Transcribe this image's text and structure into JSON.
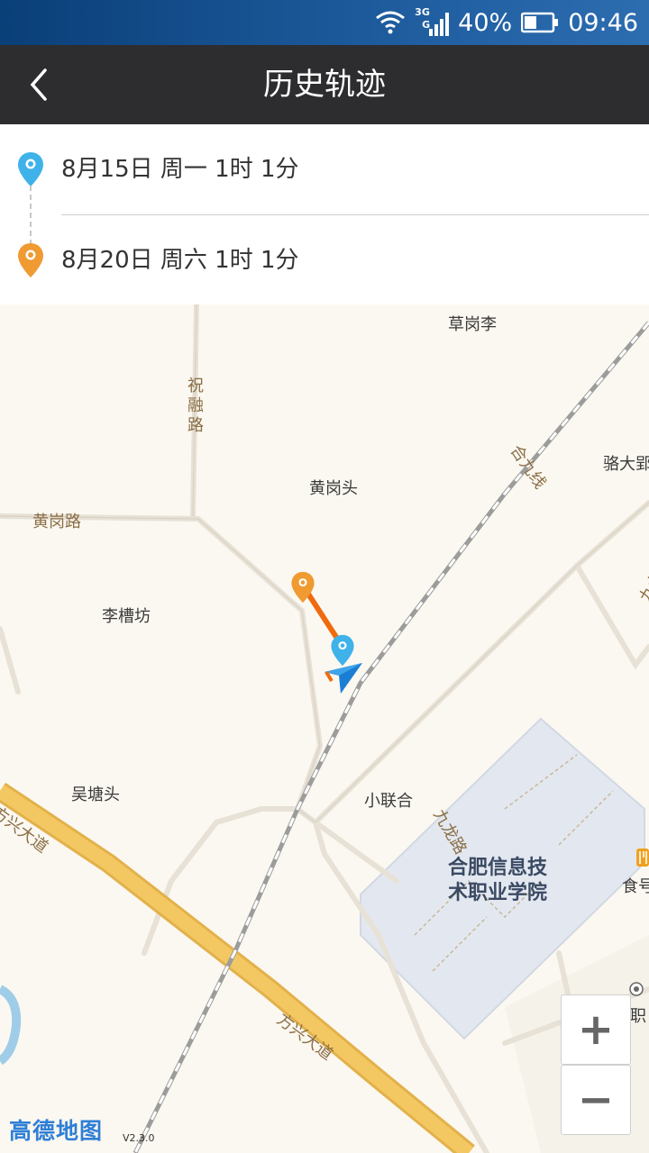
{
  "status_bar": {
    "network": "3G",
    "signal_sub": "G",
    "battery": "40%",
    "time": "09:46"
  },
  "header": {
    "title": "历史轨迹"
  },
  "trips": [
    {
      "label": "8月15日 周一 1时 1分",
      "pin_color": "#3fb2ea"
    },
    {
      "label": "8月20日 周六 1时 1分",
      "pin_color": "#f09a32"
    }
  ],
  "map": {
    "labels": {
      "cao_gang_li": "草岗李",
      "zhu_rong_lu": "祝融路",
      "he_jiu_xian": "合九线",
      "luo_da_ying": "骆大郢",
      "huang_gang_tou": "黄岗头",
      "huang_gang_lu": "黄岗路",
      "li_cao_fang": "李槽坊",
      "jiu_long_lu_1": "九龙路",
      "wu_tang_tou": "吴塘头",
      "xiao_lian_he": "小联合",
      "jiu_long_lu_2": "九龙路",
      "fang_xing_da_dao_1": "方兴大道",
      "fang_xing_da_dao_2": "方兴大道",
      "campus": "合肥信息技术职业学院",
      "food": "食号",
      "finance_school": "合肥财经职"
    },
    "zoom_in": "+",
    "zoom_out": "−",
    "brand": "高德地图",
    "version": "V2.3.0",
    "track_color": "#f06a0e"
  }
}
